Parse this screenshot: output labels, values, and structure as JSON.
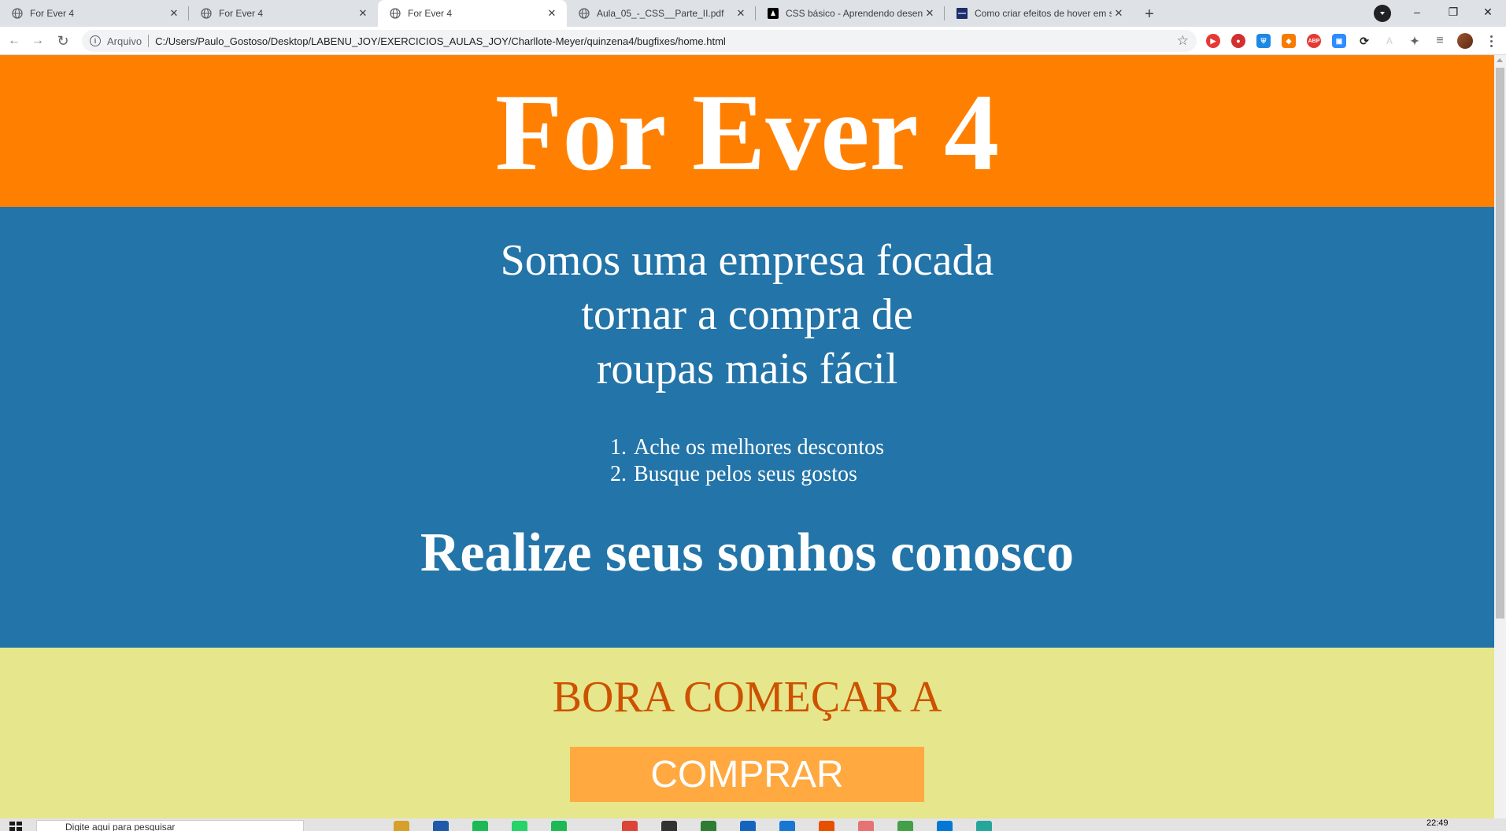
{
  "browser": {
    "tabs": [
      {
        "title": "For Ever 4",
        "favicon": "globe-icon",
        "active": false
      },
      {
        "title": "For Ever 4",
        "favicon": "globe-icon",
        "active": false
      },
      {
        "title": "For Ever 4",
        "favicon": "globe-icon",
        "active": true
      },
      {
        "title": "Aula_05_-_CSS__Parte_II.pdf",
        "favicon": "globe-icon",
        "active": false
      },
      {
        "title": "CSS básico - Aprendendo desenv",
        "favicon": "mdn-icon",
        "active": false
      },
      {
        "title": "Como criar efeitos de hover em s",
        "favicon": "site-icon",
        "active": false
      }
    ],
    "close_glyph": "✕",
    "new_tab_glyph": "+",
    "window_controls": {
      "minimize": "–",
      "restore": "❐",
      "close": "✕"
    },
    "address": {
      "scheme_label": "Arquivo",
      "url": "C:/Users/Paulo_Gostoso/Desktop/LABENU_JOY/EXERCICIOS_AULAS_JOY/Charllote-Meyer/quinzena4/bugfixes/home.html"
    },
    "nav": {
      "back": "←",
      "forward": "→",
      "reload": "↻"
    },
    "star_glyph": "☆",
    "extensions": [
      {
        "name": "youtube-extension-icon",
        "color": "#e53935",
        "glyph": "▶"
      },
      {
        "name": "record-extension-icon",
        "color": "#d32f2f",
        "glyph": "●"
      },
      {
        "name": "shield-extension-icon",
        "color": "#1e88e5",
        "glyph": "⛨"
      },
      {
        "name": "metamask-extension-icon",
        "color": "#f57c00",
        "glyph": "◆"
      },
      {
        "name": "adblock-extension-icon",
        "color": "#e53935",
        "glyph": "ABP"
      },
      {
        "name": "zoom-extension-icon",
        "color": "#2d8cff",
        "glyph": "▣"
      },
      {
        "name": "sync-extension-icon",
        "color": "#202124",
        "glyph": "⟳"
      },
      {
        "name": "translate-extension-icon",
        "color": "#dadce0",
        "glyph": "A"
      },
      {
        "name": "puzzle-extension-icon",
        "color": "#5f6368",
        "glyph": "✦"
      },
      {
        "name": "playlist-extension-icon",
        "color": "#5f6368",
        "glyph": "≡"
      }
    ],
    "colors": {
      "tabstrip": "#dee1e6",
      "omnibox": "#f1f3f4"
    }
  },
  "page": {
    "header_title": "For Ever 4",
    "lead_lines": [
      "Somos uma empresa focada",
      "tornar a compra de",
      "roupas mais fácil"
    ],
    "list": [
      {
        "num": "1.",
        "text": "Ache os melhores descontos"
      },
      {
        "num": "2.",
        "text": "Busque pelos seus gostos"
      }
    ],
    "tagline": "Realize seus sonhos conosco",
    "cta_text": "BORA COMEÇAR A",
    "buy_button": "COMPRAR",
    "colors": {
      "header_bg": "#ff8000",
      "main_bg": "#2374a8",
      "cta_bg": "#e6e68c",
      "cta_text": "#cc5200",
      "button_bg": "#ffa940"
    }
  },
  "taskbar": {
    "search_placeholder": "Digite aqui para pesquisar",
    "clock": "22:49"
  }
}
